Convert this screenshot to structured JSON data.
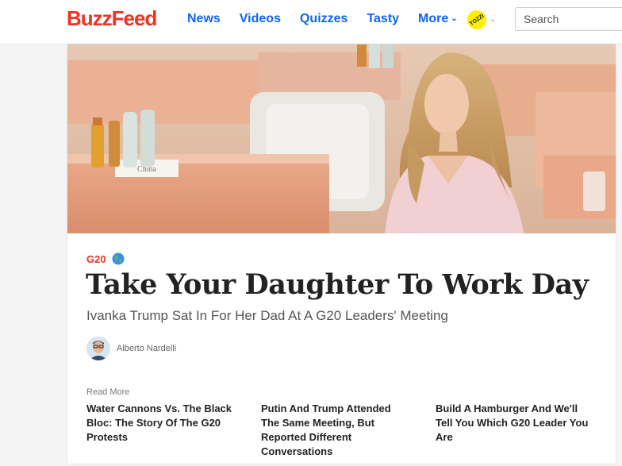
{
  "header": {
    "logo": "BuzzFeed",
    "nav": [
      {
        "label": "News"
      },
      {
        "label": "Videos"
      },
      {
        "label": "Quizzes"
      },
      {
        "label": "Tasty"
      },
      {
        "label": "More"
      }
    ],
    "badge_text": "TOZZI",
    "search_placeholder": "Search"
  },
  "article": {
    "tag": "G20",
    "headline": "Take Your Daughter To Work Day",
    "subheadline": "Ivanka Trump Sat In For Her Dad At A G20 Leaders' Meeting",
    "author": "Alberto Nardelli",
    "hero_nameplate": "China"
  },
  "read_more": {
    "label": "Read More",
    "items": [
      {
        "title": "Water Cannons Vs. The Black Bloc: The Story Of The G20 Protests"
      },
      {
        "title": "Putin And Trump Attended The Same Meeting, But Reported Different Conversations"
      },
      {
        "title": "Build A Hamburger And We'll Tell You Which G20 Leader You Are"
      }
    ]
  },
  "colors": {
    "brand_red": "#ee3322",
    "nav_blue": "#0f65ef",
    "badge_yellow": "#ffee00"
  }
}
